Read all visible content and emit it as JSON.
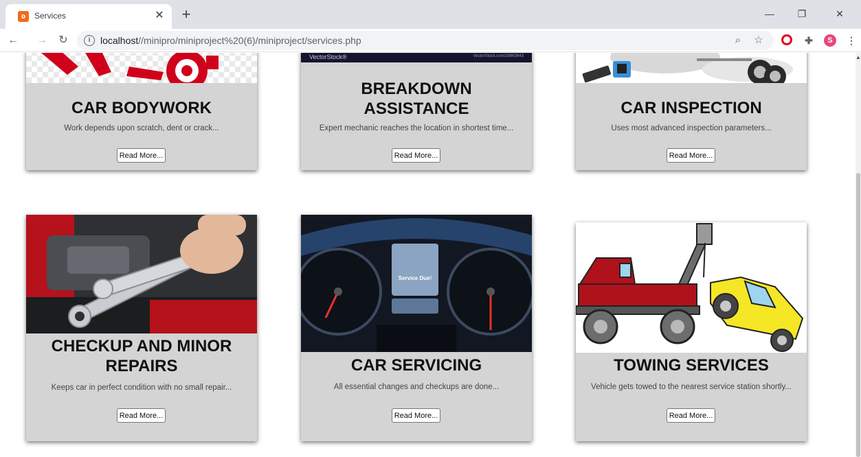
{
  "browser": {
    "tab_title": "Services",
    "tab_close": "✕",
    "new_tab": "+",
    "url_host": "localhost",
    "url_path": "//minipro/miniproject%20(6)/miniproject/services.php",
    "window_controls": {
      "minimize": "—",
      "restore": "❐",
      "close": "✕"
    },
    "profile_initial": "S"
  },
  "services": [
    {
      "title": "CAR BODYWORK",
      "desc": "Work depends upon scratch, dent or crack...",
      "button": "Read More..."
    },
    {
      "title": "BREAKDOWN ASSISTANCE",
      "desc": "Expert mechanic reaches the location in shortest time...",
      "button": "Read More...",
      "image_caption_left": "VectorStock®",
      "image_caption_right": "VectorStock.com/28963643"
    },
    {
      "title": "CAR INSPECTION",
      "desc": "Uses most advanced inspection parameters...",
      "button": "Read More..."
    },
    {
      "title": "CHECKUP AND MINOR REPAIRS",
      "desc": "Keeps car in perfect condition with no small repair...",
      "button": "Read More..."
    },
    {
      "title": "CAR SERVICING",
      "desc": "All essential changes and checkups are done...",
      "button": "Read More...",
      "image_screen_text": "Service Due!"
    },
    {
      "title": "TOWING SERVICES",
      "desc": "Vehicle gets towed to the nearest service station shortly...",
      "button": "Read More..."
    }
  ],
  "colors": {
    "card_bg": "#d4d4d4",
    "page_bg": "#ffffff",
    "chrome_bg": "#dee1e6",
    "brand_red": "#d0021b"
  },
  "icons": [
    "back-arrow-icon",
    "forward-arrow-icon",
    "reload-icon",
    "info-icon",
    "zoom-icon",
    "star-icon",
    "opera-icon",
    "puzzle-icon",
    "menu-dots-icon"
  ]
}
